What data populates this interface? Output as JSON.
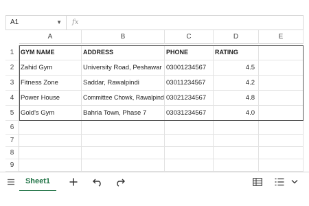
{
  "formula_bar": {
    "cell_ref": "A1",
    "fx_label": "fx",
    "formula": ""
  },
  "grid": {
    "columns": [
      "A",
      "B",
      "C",
      "D",
      "E"
    ],
    "rows": [
      "1",
      "2",
      "3",
      "4",
      "5",
      "6",
      "7",
      "8",
      "9"
    ],
    "header": [
      "GYM NAME",
      "ADDRESS",
      "PHONE",
      "RATING"
    ],
    "data": [
      [
        "Zahid Gym",
        "University Road, Peshawar",
        "03001234567",
        "4.5"
      ],
      [
        "Fitness Zone",
        "Saddar, Rawalpindi",
        "03011234567",
        "4.2"
      ],
      [
        "Power House",
        "Committee Chowk, Rawalpindi",
        "03021234567",
        "4.8"
      ],
      [
        "Gold's Gym",
        "Bahria Town, Phase 7",
        "03031234567",
        "4.0"
      ]
    ]
  },
  "bottom_bar": {
    "menu_icon": "hamburger-menu-icon",
    "sheet_tab": "Sheet1",
    "add_icon": "plus-icon",
    "undo_icon": "undo-icon",
    "redo_icon": "redo-icon",
    "grid_view_icon": "table-grid-icon",
    "list_icon": "list-icon",
    "chevron_icon": "chevron-down-icon"
  },
  "colors": {
    "accent": "#217346",
    "border": "#d6d6d6",
    "table_border": "#555555"
  }
}
